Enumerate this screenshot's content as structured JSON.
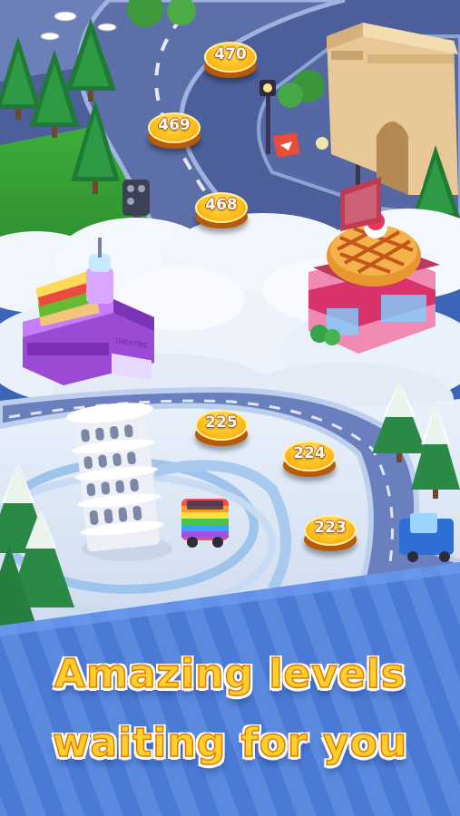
{
  "map": {
    "levels_upper": [
      {
        "number": "470"
      },
      {
        "number": "469"
      },
      {
        "number": "468"
      }
    ],
    "levels_lower": [
      {
        "number": "225"
      },
      {
        "number": "224"
      },
      {
        "number": "223"
      }
    ],
    "theatre_sign": "THEATRE"
  },
  "banner": {
    "line1": "Amazing levels",
    "line2": "waiting for you"
  },
  "colors": {
    "sky_top": "#2b4a99",
    "road": "#5d6fa8",
    "cloud": "#eef3fb",
    "snow": "#e6eef8",
    "banner_stripe_light": "#5d8fe0",
    "banner_stripe_dark": "#4474cf",
    "headline": "#ffcf2e",
    "level_node": "#ffc21f"
  }
}
